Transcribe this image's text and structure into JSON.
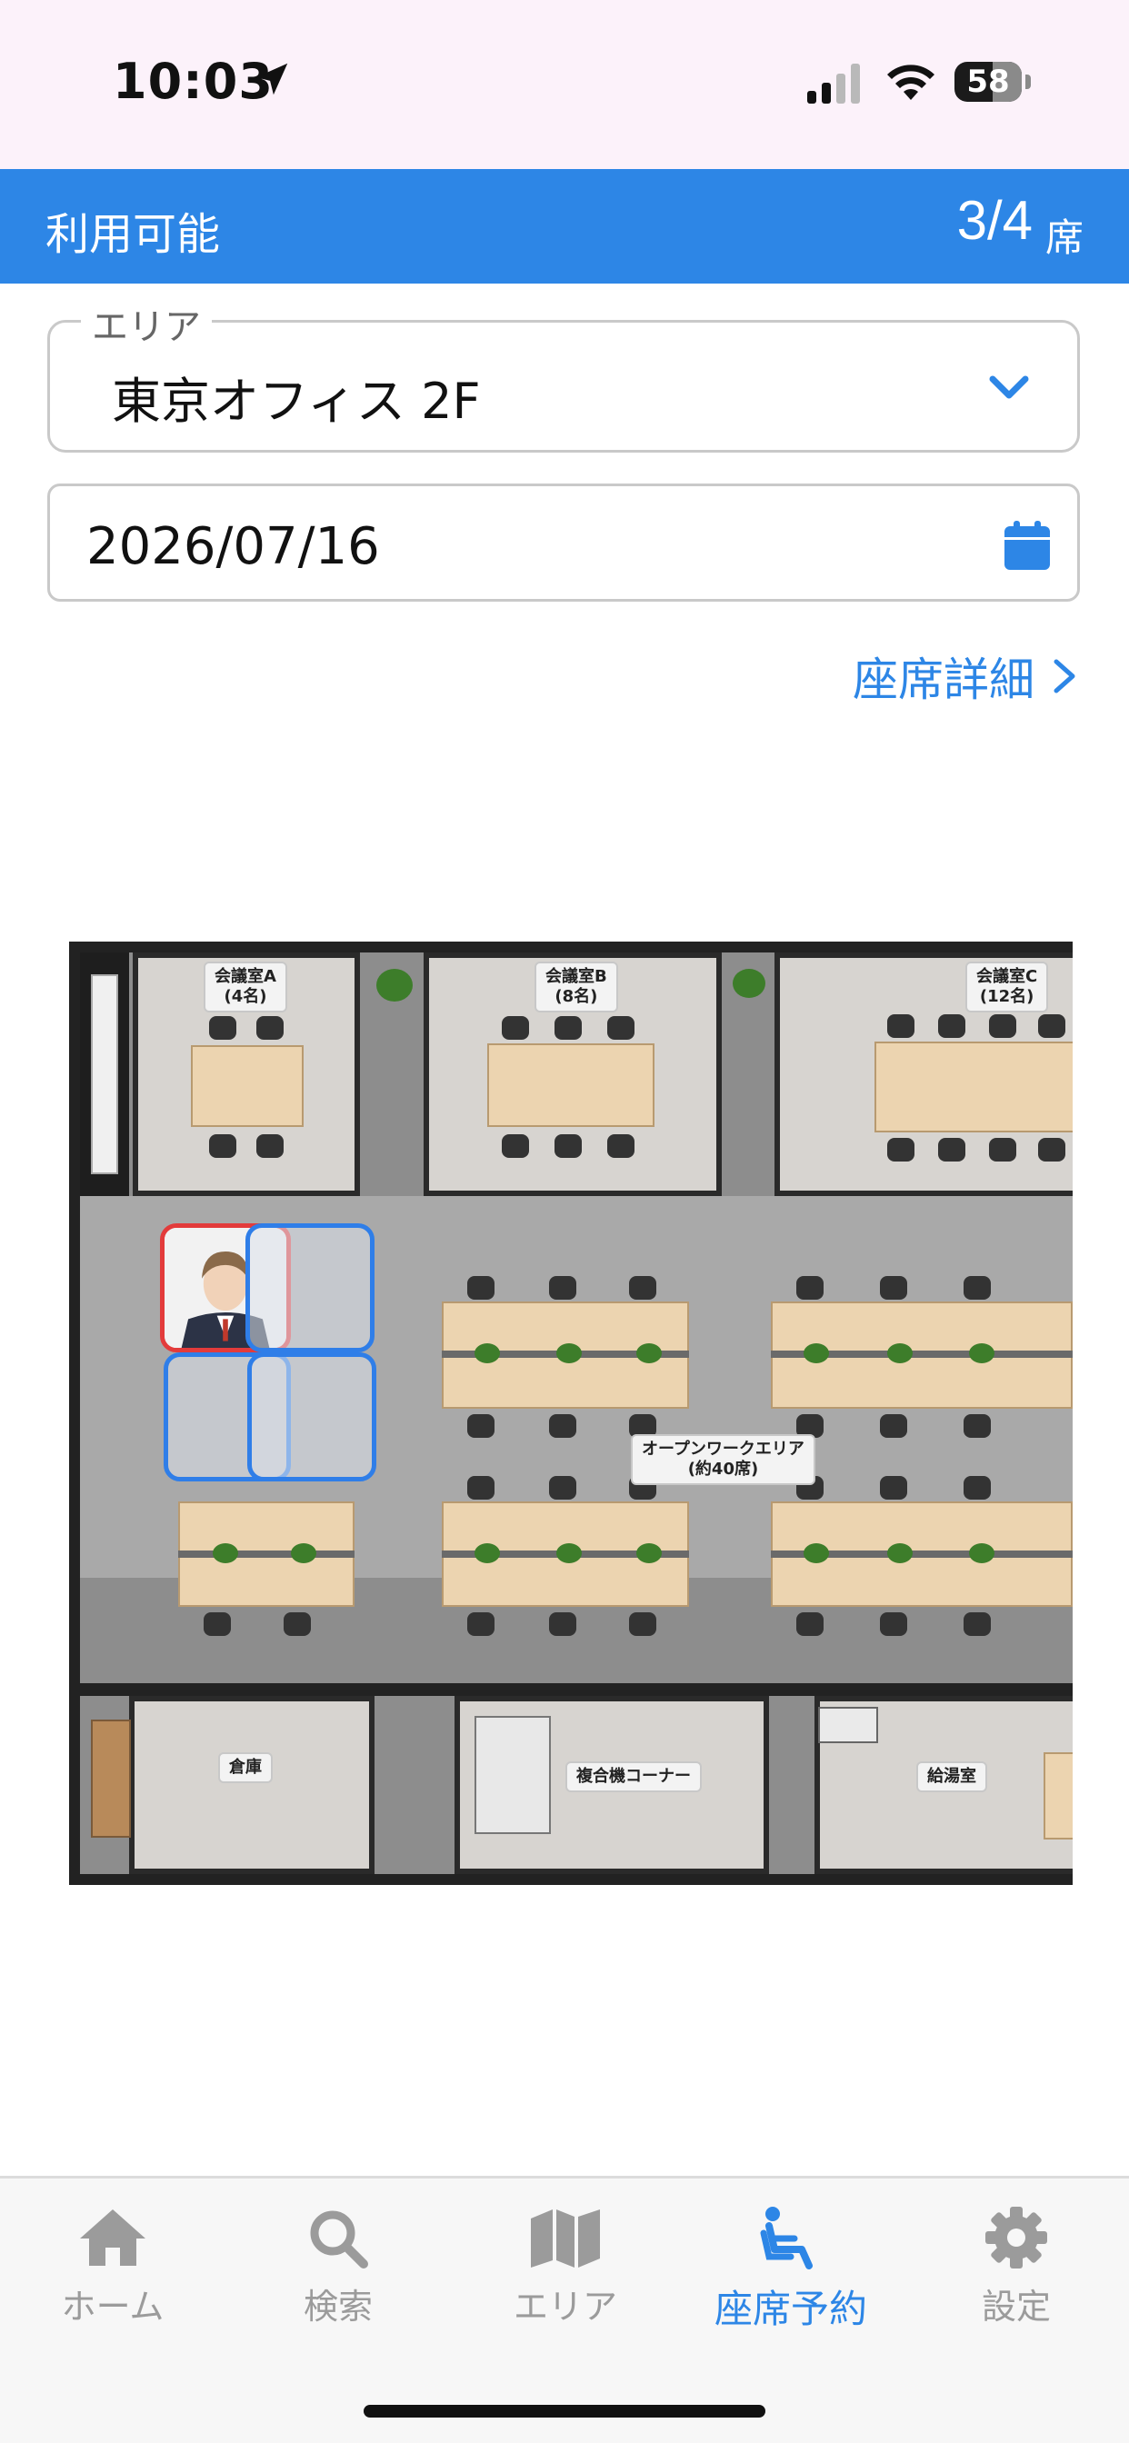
{
  "status": {
    "time": "10:03",
    "battery": "58"
  },
  "availability": {
    "label": "利用可能",
    "count": "3/4",
    "unit": "席"
  },
  "area": {
    "legend": "エリア",
    "value": "東京オフィス 2F"
  },
  "date": {
    "value": "2026/07/16"
  },
  "detail_link": "座席詳細",
  "map": {
    "room_a": "会議室A\n(4名)",
    "room_b": "会議室B\n(8名)",
    "room_c": "会議室C\n(12名)",
    "open_area": "オープンワークエリア\n(約40席)",
    "storage": "倉庫",
    "copier": "複合機コーナー",
    "kitchen": "給湯室"
  },
  "tabs": [
    {
      "label": "ホーム",
      "icon": "home-icon"
    },
    {
      "label": "検索",
      "icon": "search-icon"
    },
    {
      "label": "エリア",
      "icon": "map-icon"
    },
    {
      "label": "座席予約",
      "icon": "seat-icon"
    },
    {
      "label": "設定",
      "icon": "gear-icon"
    }
  ],
  "colors": {
    "accent": "#2d86e6",
    "status_bg": "#fcf2fa",
    "my_seat": "#e33b3b",
    "inactive": "#9b9b9b"
  }
}
